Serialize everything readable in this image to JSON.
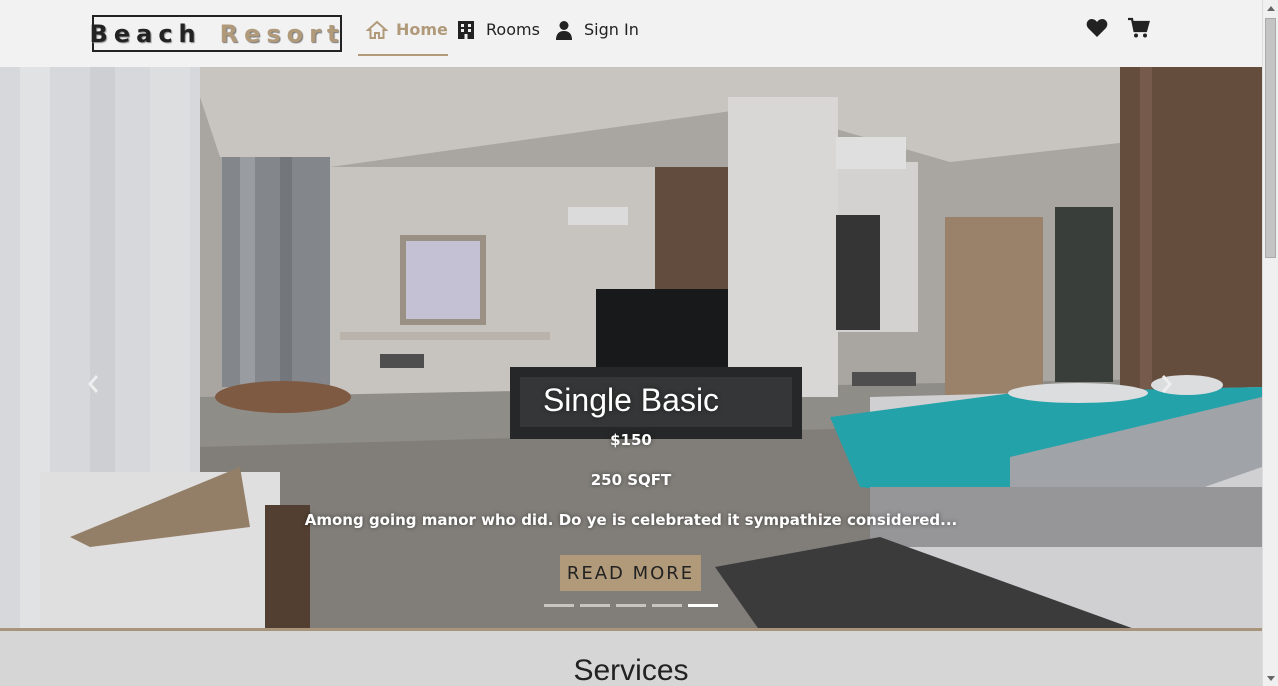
{
  "navbar": {
    "brand_word1": "Beach",
    "brand_word2": "Resort",
    "links": [
      {
        "label": "Home",
        "icon": "home-icon"
      },
      {
        "label": "Rooms",
        "icon": "building-icon"
      },
      {
        "label": "Sign In",
        "icon": "user-icon"
      }
    ],
    "actions": [
      {
        "icon": "heart-icon"
      },
      {
        "icon": "cart-icon"
      }
    ]
  },
  "carousel": {
    "slide": {
      "title": "Single Basic",
      "price": "$150",
      "size": "250 SQFT",
      "description": "Among going manor who did. Do ye is celebrated it sympathize considered...",
      "button_label": "READ MORE"
    },
    "prev_icon": "chevron-left-icon",
    "next_icon": "chevron-right-icon",
    "indicator_count": 5,
    "active_indicator": 5
  },
  "services": {
    "title": "Services"
  },
  "colors": {
    "accent": "#b09a7a",
    "navbar_bg": "#f2f2f2",
    "section_bg": "#d6d6d6"
  }
}
